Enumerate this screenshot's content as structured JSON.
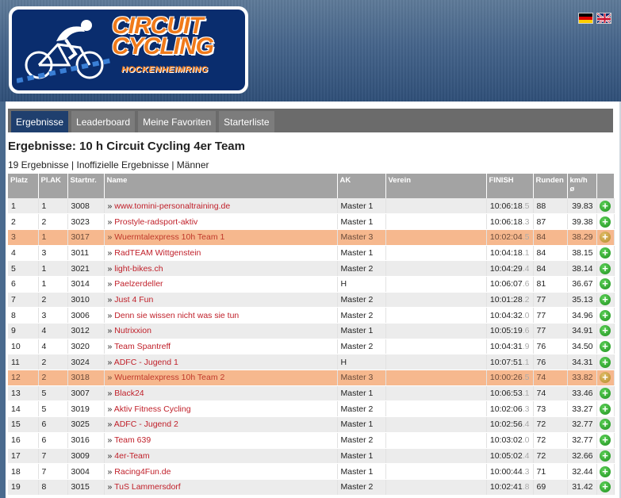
{
  "header": {
    "logo_line1": "CIRCUIT",
    "logo_line2": "CYCLING",
    "logo_line3": "HOCKENHEIMRING",
    "languages": [
      "de",
      "en"
    ]
  },
  "tabs": [
    {
      "label": "Ergebnisse",
      "active": true
    },
    {
      "label": "Leaderboard",
      "active": false
    },
    {
      "label": "Meine Favoriten",
      "active": false
    },
    {
      "label": "Starterliste",
      "active": false
    }
  ],
  "page": {
    "title": "Ergebnisse: 10 h Circuit Cycling 4er Team",
    "subline": "19 Ergebnisse | Inoffizielle Ergebnisse | Männer"
  },
  "table": {
    "columns": [
      "Platz",
      "Pl.AK",
      "Startnr.",
      "Name",
      "AK",
      "Verein",
      "FINISH",
      "Runden",
      "km/h ø"
    ],
    "rows": [
      {
        "platz": "1",
        "plak": "1",
        "nr": "3008",
        "name": "www.tomini-personaltraining.de",
        "ak": "Master 1",
        "verein": "",
        "finish": "10:06:18",
        "ms": ".5",
        "runden": "88",
        "kmh": "39.83",
        "highlight": false
      },
      {
        "platz": "2",
        "plak": "2",
        "nr": "3023",
        "name": "Prostyle-radsport-aktiv",
        "ak": "Master 1",
        "verein": "",
        "finish": "10:06:18",
        "ms": ".3",
        "runden": "87",
        "kmh": "39.38",
        "highlight": false
      },
      {
        "platz": "3",
        "plak": "1",
        "nr": "3017",
        "name": "Wuermtalexpress 10h Team 1",
        "ak": "Master 3",
        "verein": "",
        "finish": "10:02:04",
        "ms": ".5",
        "runden": "84",
        "kmh": "38.29",
        "highlight": true
      },
      {
        "platz": "4",
        "plak": "3",
        "nr": "3011",
        "name": "RadTEAM Wittgenstein",
        "ak": "Master 1",
        "verein": "",
        "finish": "10:04:18",
        "ms": ".1",
        "runden": "84",
        "kmh": "38.15",
        "highlight": false
      },
      {
        "platz": "5",
        "plak": "1",
        "nr": "3021",
        "name": "light-bikes.ch",
        "ak": "Master 2",
        "verein": "",
        "finish": "10:04:29",
        "ms": ".4",
        "runden": "84",
        "kmh": "38.14",
        "highlight": false
      },
      {
        "platz": "6",
        "plak": "1",
        "nr": "3014",
        "name": "Paelzerdeller",
        "ak": "H",
        "verein": "",
        "finish": "10:06:07",
        "ms": ".6",
        "runden": "81",
        "kmh": "36.67",
        "highlight": false
      },
      {
        "platz": "7",
        "plak": "2",
        "nr": "3010",
        "name": "Just 4 Fun",
        "ak": "Master 2",
        "verein": "",
        "finish": "10:01:28",
        "ms": ".2",
        "runden": "77",
        "kmh": "35.13",
        "highlight": false
      },
      {
        "platz": "8",
        "plak": "3",
        "nr": "3006",
        "name": "Denn sie wissen nicht was sie tun",
        "ak": "Master 2",
        "verein": "",
        "finish": "10:04:32",
        "ms": ".0",
        "runden": "77",
        "kmh": "34.96",
        "highlight": false
      },
      {
        "platz": "9",
        "plak": "4",
        "nr": "3012",
        "name": "Nutrixxion",
        "ak": "Master 1",
        "verein": "",
        "finish": "10:05:19",
        "ms": ".6",
        "runden": "77",
        "kmh": "34.91",
        "highlight": false
      },
      {
        "platz": "10",
        "plak": "4",
        "nr": "3020",
        "name": "Team Spantreff",
        "ak": "Master 2",
        "verein": "",
        "finish": "10:04:31",
        "ms": ".9",
        "runden": "76",
        "kmh": "34.50",
        "highlight": false
      },
      {
        "platz": "11",
        "plak": "2",
        "nr": "3024",
        "name": "ADFC - Jugend 1",
        "ak": "H",
        "verein": "",
        "finish": "10:07:51",
        "ms": ".1",
        "runden": "76",
        "kmh": "34.31",
        "highlight": false
      },
      {
        "platz": "12",
        "plak": "2",
        "nr": "3018",
        "name": "Wuermtalexpress 10h Team 2",
        "ak": "Master 3",
        "verein": "",
        "finish": "10:00:26",
        "ms": ".5",
        "runden": "74",
        "kmh": "33.82",
        "highlight": true
      },
      {
        "platz": "13",
        "plak": "5",
        "nr": "3007",
        "name": "Black24",
        "ak": "Master 1",
        "verein": "",
        "finish": "10:06:53",
        "ms": ".1",
        "runden": "74",
        "kmh": "33.46",
        "highlight": false
      },
      {
        "platz": "14",
        "plak": "5",
        "nr": "3019",
        "name": "Aktiv Fitness Cycling",
        "ak": "Master 2",
        "verein": "",
        "finish": "10:02:06",
        "ms": ".3",
        "runden": "73",
        "kmh": "33.27",
        "highlight": false
      },
      {
        "platz": "15",
        "plak": "6",
        "nr": "3025",
        "name": "ADFC - Jugend 2",
        "ak": "Master 1",
        "verein": "",
        "finish": "10:02:56",
        "ms": ".4",
        "runden": "72",
        "kmh": "32.77",
        "highlight": false
      },
      {
        "platz": "16",
        "plak": "6",
        "nr": "3016",
        "name": "Team 639",
        "ak": "Master 2",
        "verein": "",
        "finish": "10:03:02",
        "ms": ".0",
        "runden": "72",
        "kmh": "32.77",
        "highlight": false
      },
      {
        "platz": "17",
        "plak": "7",
        "nr": "3009",
        "name": "4er-Team",
        "ak": "Master 1",
        "verein": "",
        "finish": "10:05:02",
        "ms": ".4",
        "runden": "72",
        "kmh": "32.66",
        "highlight": false
      },
      {
        "platz": "18",
        "plak": "7",
        "nr": "3004",
        "name": "Racing4Fun.de",
        "ak": "Master 1",
        "verein": "",
        "finish": "10:00:44",
        "ms": ".3",
        "runden": "71",
        "kmh": "32.44",
        "highlight": false
      },
      {
        "platz": "19",
        "plak": "8",
        "nr": "3015",
        "name": "TuS Lammersdorf",
        "ak": "Master 2",
        "verein": "",
        "finish": "10:02:41",
        "ms": ".8",
        "runden": "69",
        "kmh": "31.42",
        "highlight": false
      }
    ]
  }
}
